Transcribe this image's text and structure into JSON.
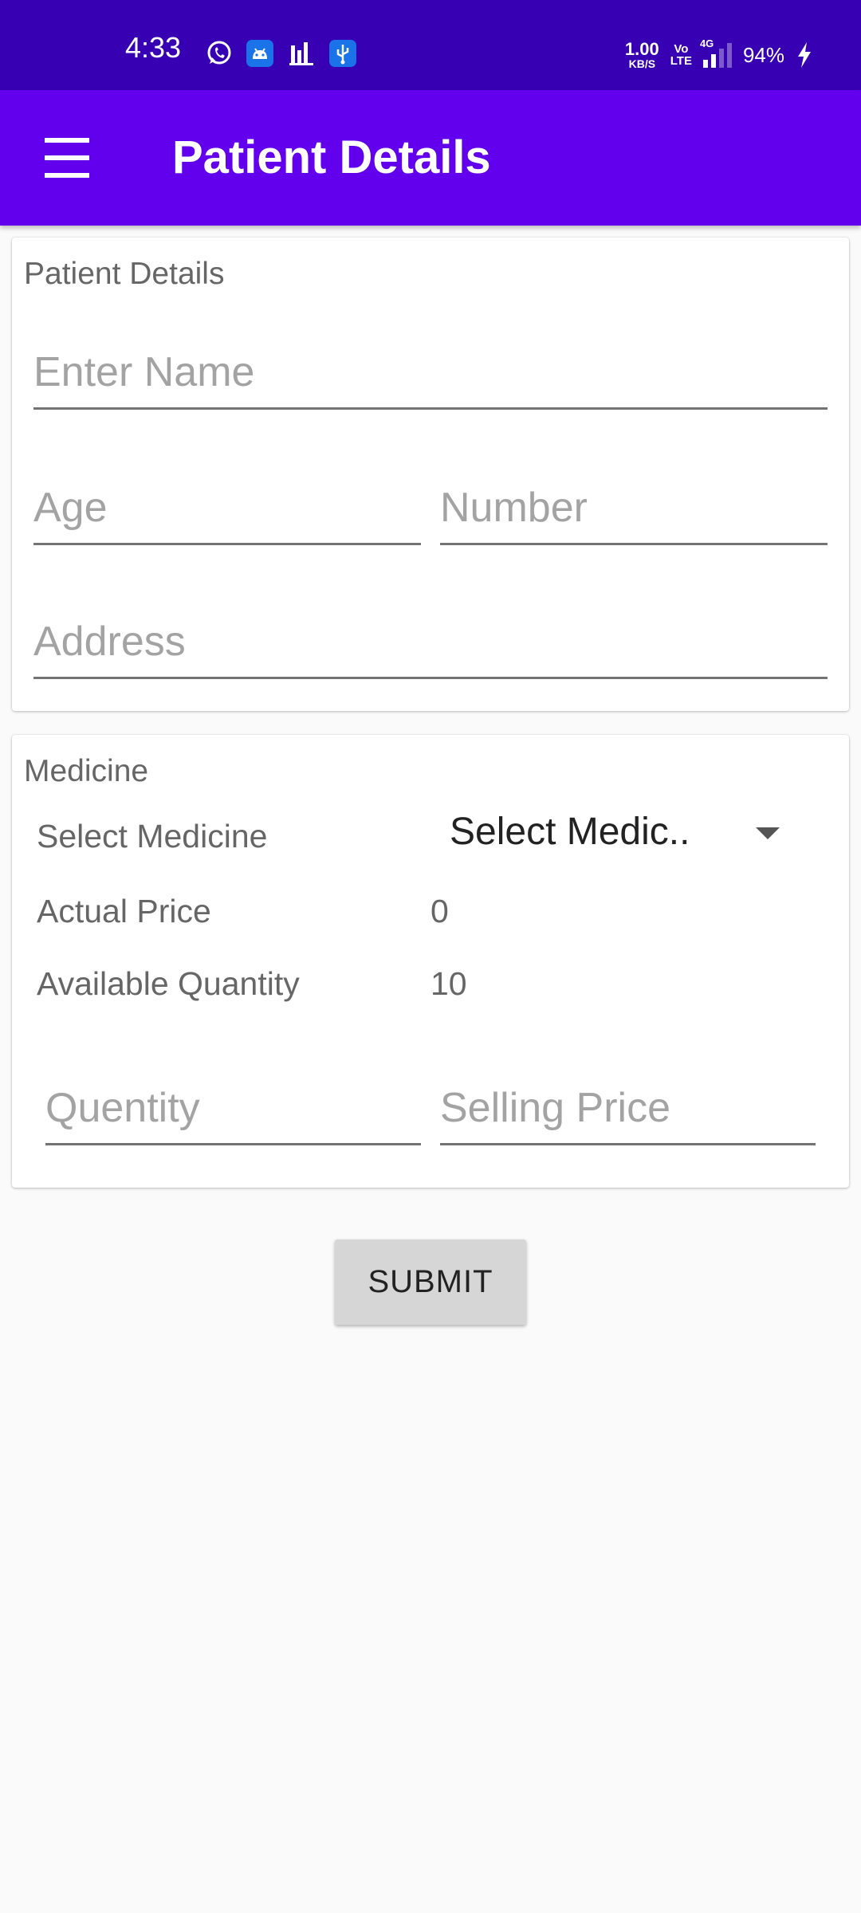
{
  "status_bar": {
    "time": "4:33",
    "icons": [
      "whatsapp-icon",
      "android-icon",
      "bar-chart-icon",
      "usb-icon"
    ],
    "net_speed_value": "1.00",
    "net_speed_unit": "KB/S",
    "volte_top": "Vo",
    "volte_bottom": "LTE",
    "network_type": "4G",
    "battery": "94%"
  },
  "app_bar": {
    "title": "Patient Details",
    "menu_icon": "hamburger-menu-icon",
    "color": "#6200ee"
  },
  "patient_card": {
    "title": "Patient Details",
    "name_placeholder": "Enter Name",
    "name_value": "",
    "age_placeholder": "Age",
    "age_value": "",
    "number_placeholder": "Number",
    "number_value": "",
    "address_placeholder": "Address",
    "address_value": ""
  },
  "medicine_card": {
    "title": "Medicine",
    "select_label": "Select Medicine",
    "select_value": "Select Medic..",
    "actual_price_label": "Actual Price",
    "actual_price_value": "0",
    "available_quantity_label": "Available Quantity",
    "available_quantity_value": "10",
    "quantity_placeholder": "Quentity",
    "quantity_value": "",
    "selling_price_placeholder": "Selling Price",
    "selling_price_value": ""
  },
  "submit_label": "SUBMIT",
  "colors": {
    "status_bar": "#3700b3",
    "app_bar": "#6200ee",
    "background": "#fafafa",
    "button": "#d6d6d6"
  }
}
